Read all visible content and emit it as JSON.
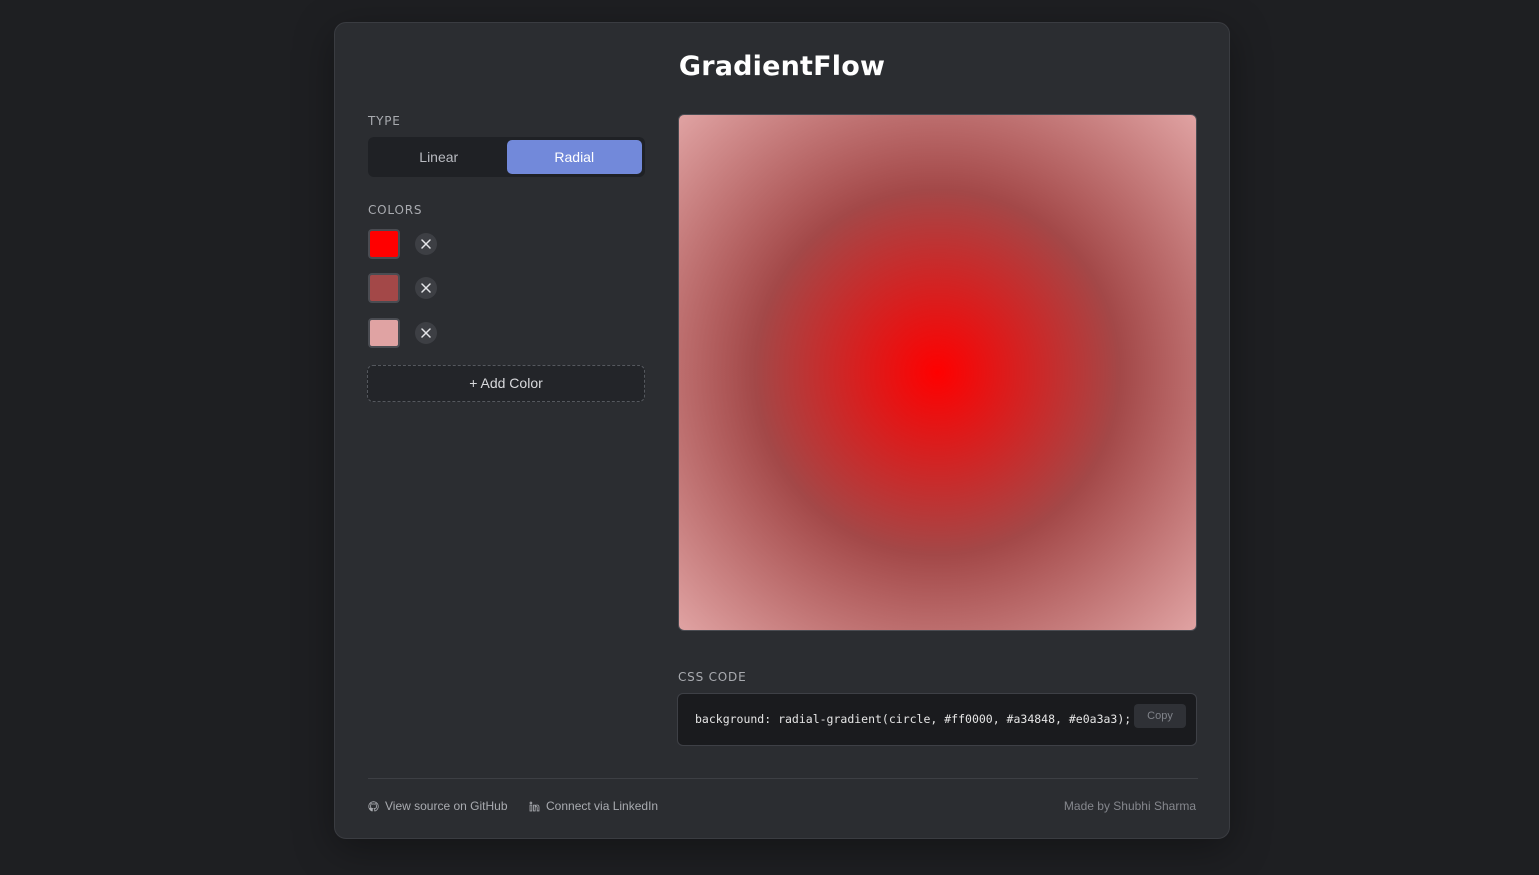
{
  "app": {
    "title": "GradientFlow"
  },
  "type_section": {
    "label": "TYPE",
    "options": [
      {
        "label": "Linear",
        "active": false
      },
      {
        "label": "Radial",
        "active": true
      }
    ]
  },
  "colors_section": {
    "label": "COLORS",
    "colors": [
      "#ff0000",
      "#a34848",
      "#e0a3a3"
    ],
    "add_label": "+ Add Color"
  },
  "css_section": {
    "label": "CSS CODE",
    "code": "background: radial-gradient(circle, #ff0000, #a34848, #e0a3a3);",
    "copy_label": "Copy"
  },
  "footer": {
    "github_label": "View source on GitHub",
    "linkedin_label": "Connect via LinkedIn",
    "credit": "Made by Shubhi Sharma"
  },
  "theme": {
    "accent": "#7289da",
    "background": "#1e1f22",
    "card": "#2b2d31"
  },
  "icons": {
    "remove": "close-icon",
    "github": "github-icon",
    "linkedin": "linkedin-icon"
  }
}
